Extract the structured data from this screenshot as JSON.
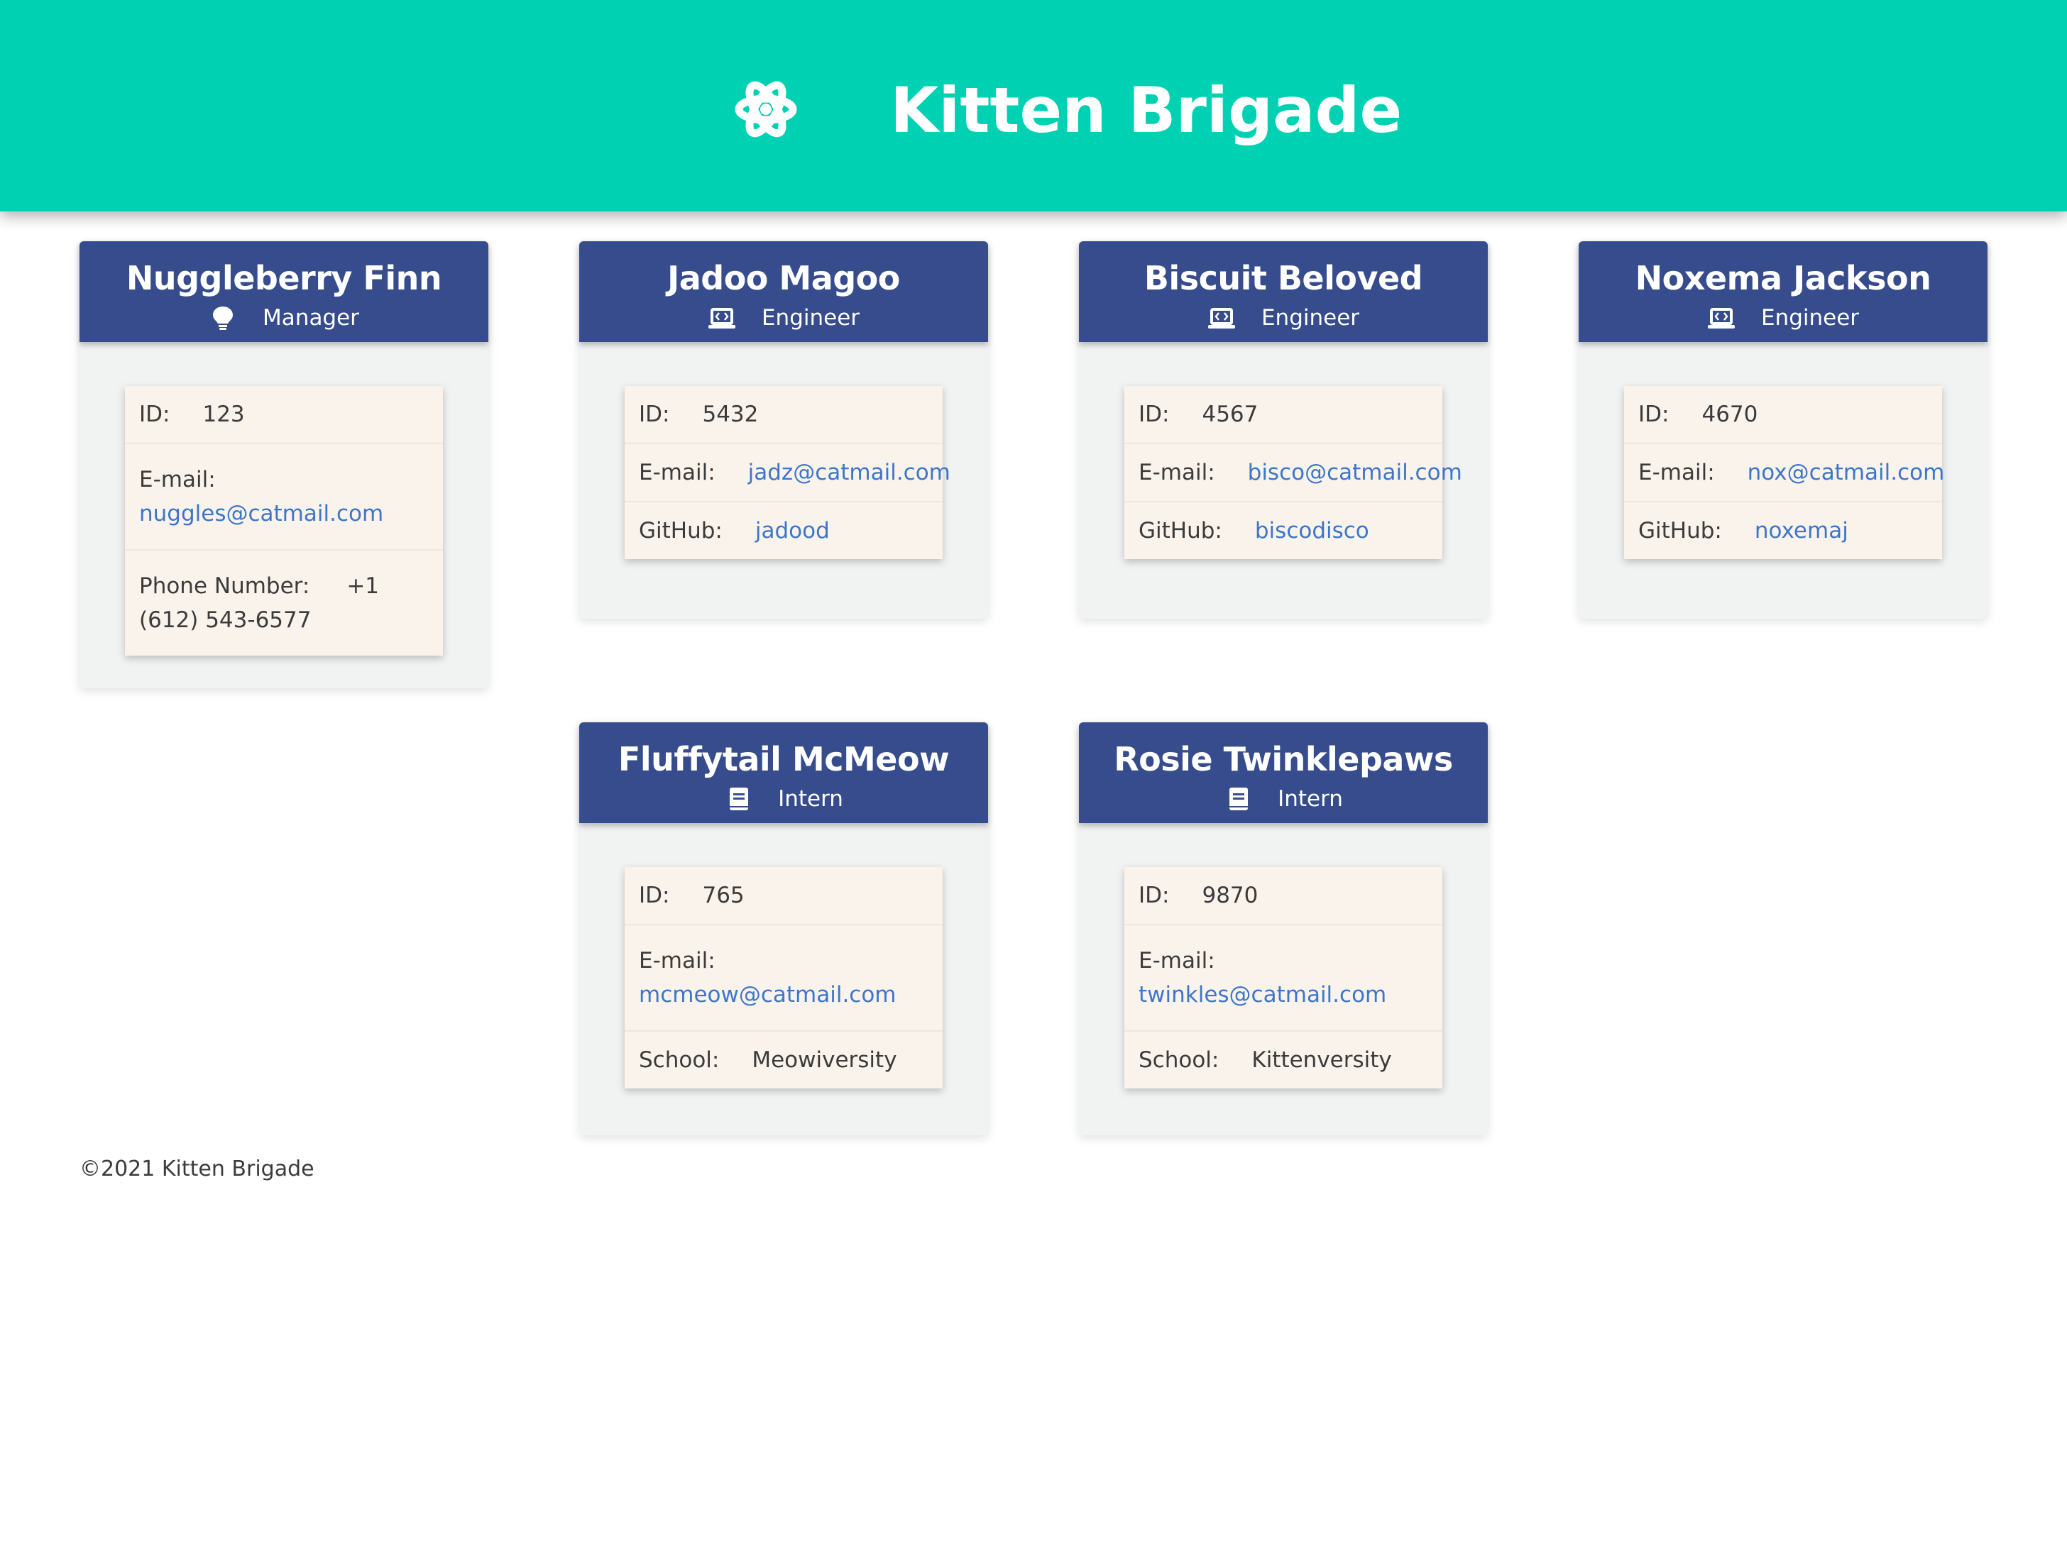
{
  "header": {
    "title": "Kitten Brigade",
    "icon": "atom-icon",
    "background": "#00d1b2"
  },
  "team": [
    {
      "name": "Nuggleberry Finn",
      "role": "Manager",
      "role_icon": "lightbulb-icon",
      "id_label": "ID:",
      "id": "123",
      "email_label": "E-mail:",
      "email": "nuggles@catmail.com",
      "extra_label": "Phone Number:",
      "extra_value": "+1 (612) 543-6577"
    },
    {
      "name": "Jadoo Magoo",
      "role": "Engineer",
      "role_icon": "laptop-code-icon",
      "id_label": "ID:",
      "id": "5432",
      "email_label": "E-mail:",
      "email": "jadz@catmail.com",
      "extra_label": "GitHub:",
      "extra_value": "jadood"
    },
    {
      "name": "Biscuit Beloved",
      "role": "Engineer",
      "role_icon": "laptop-code-icon",
      "id_label": "ID:",
      "id": "4567",
      "email_label": "E-mail:",
      "email": "bisco@catmail.com",
      "extra_label": "GitHub:",
      "extra_value": "biscodisco"
    },
    {
      "name": "Noxema Jackson",
      "role": "Engineer",
      "role_icon": "laptop-code-icon",
      "id_label": "ID:",
      "id": "4670",
      "email_label": "E-mail:",
      "email": "nox@catmail.com",
      "extra_label": "GitHub:",
      "extra_value": "noxemaj"
    },
    {
      "name": "Fluffytail McMeow",
      "role": "Intern",
      "role_icon": "book-icon",
      "id_label": "ID:",
      "id": "765",
      "email_label": "E-mail:",
      "email": "mcmeow@catmail.com",
      "extra_label": "School:",
      "extra_value": "Meowiversity"
    },
    {
      "name": "Rosie Twinklepaws",
      "role": "Intern",
      "role_icon": "book-icon",
      "id_label": "ID:",
      "id": "9870",
      "email_label": "E-mail:",
      "email": "twinkles@catmail.com",
      "extra_label": "School:",
      "extra_value": "Kittenversity"
    }
  ],
  "footer": {
    "text": "©2021 Kitten Brigade"
  },
  "colors": {
    "accent": "#00d1b2",
    "card_header": "#364c8d",
    "card_body": "#f1f2f2",
    "info_background": "#faf3ec",
    "link": "#3d76c9"
  }
}
